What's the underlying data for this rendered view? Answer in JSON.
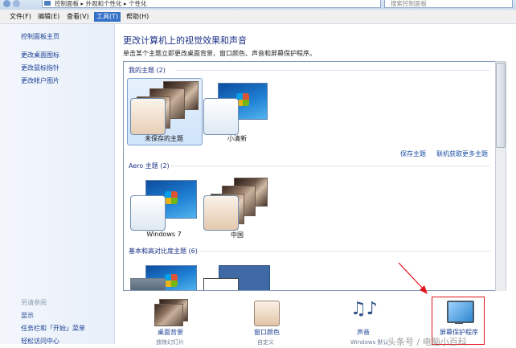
{
  "address_bar": {
    "path": "控制面板 ▸ 外观和个性化 ▸ 个性化",
    "search_placeholder": "搜索控制面板"
  },
  "menu": [
    "文件(F)",
    "编辑(E)",
    "查看(V)",
    "工具(T)",
    "帮助(H)"
  ],
  "menu_active_index": 3,
  "left_pane": {
    "links": [
      "控制面板主页",
      "更改桌面图标",
      "更改鼠标指针",
      "更改帐户图片"
    ],
    "see_also_heading": "另请参阅",
    "see_also": [
      "显示",
      "任务栏和「开始」菜单",
      "轻松访问中心"
    ]
  },
  "main": {
    "title": "更改计算机上的视觉效果和声音",
    "description": "单击某个主题立即更改桌面背景、窗口颜色、声音和屏幕保护程序。",
    "groups": {
      "my_themes": {
        "title": "我的主题 (2)",
        "items": [
          "未保存的主题",
          "小清新"
        ],
        "selected": "未保存的主题"
      },
      "save_theme_link": "保存主题",
      "online_themes_link": "联机获取更多主题",
      "aero": {
        "title": "Aero 主题 (2)",
        "items": [
          "Windows 7",
          "中国"
        ]
      },
      "basic": {
        "title": "基本和高对比度主题 (6)"
      }
    }
  },
  "bottom": {
    "items": [
      {
        "label": "桌面背景",
        "sub": "放映幻灯片"
      },
      {
        "label": "窗口颜色",
        "sub": "自定义"
      },
      {
        "label": "声音",
        "sub": "Windows 默认"
      },
      {
        "label": "屏幕保护程序",
        "sub": ""
      }
    ]
  },
  "watermark": "头条号 / 电脑小百科",
  "colors": {
    "link": "#1a3f94",
    "title": "#1e3287",
    "highlight": "#3370c7",
    "annotation": "#e0141a"
  }
}
